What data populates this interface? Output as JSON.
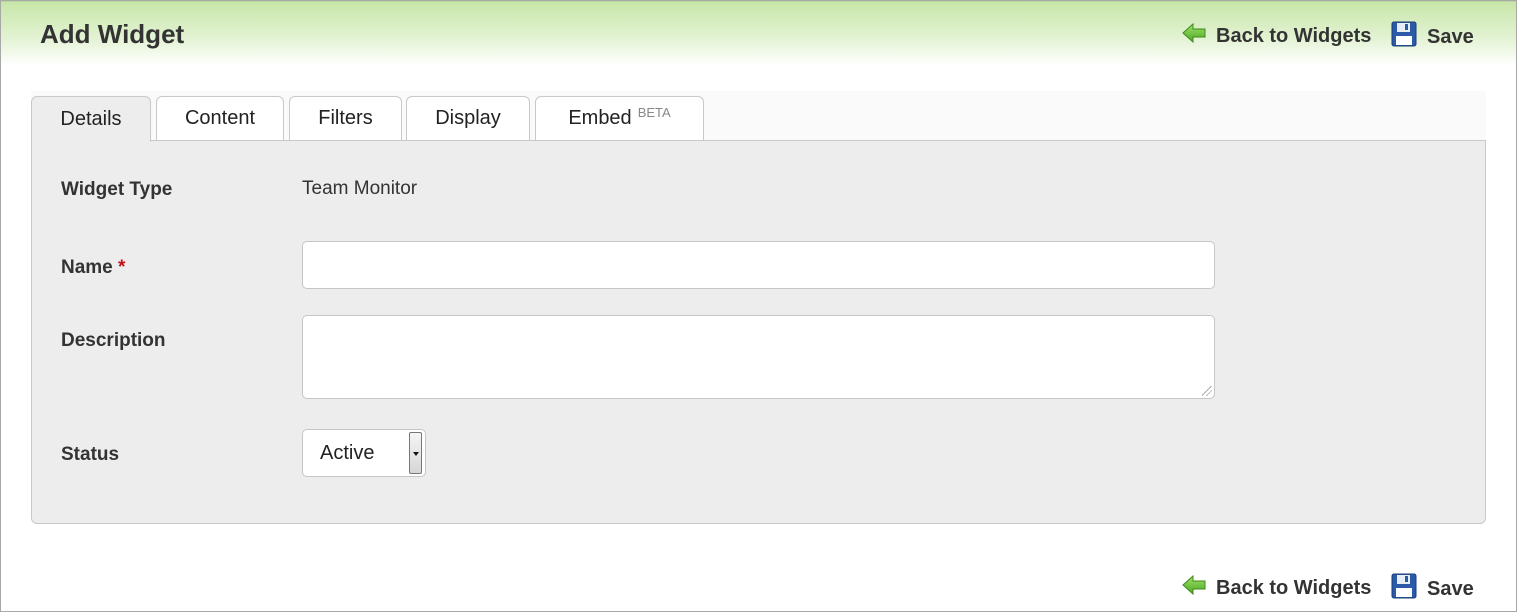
{
  "header": {
    "title": "Add Widget",
    "back_label": "Back to Widgets",
    "save_label": "Save"
  },
  "icons": {
    "back": "green-arrow-left-icon",
    "save": "floppy-disk-icon"
  },
  "tabs": [
    {
      "label": "Details",
      "active": true
    },
    {
      "label": "Content",
      "active": false
    },
    {
      "label": "Filters",
      "active": false
    },
    {
      "label": "Display",
      "active": false
    },
    {
      "label": "Embed",
      "badge": "BETA",
      "active": false
    }
  ],
  "form": {
    "widget_type_label": "Widget Type",
    "widget_type_value": "Team Monitor",
    "name_label": "Name",
    "required_marker": "*",
    "name_value": "",
    "description_label": "Description",
    "description_value": "",
    "status_label": "Status",
    "status_value": "Active"
  },
  "footer": {
    "back_label": "Back to Widgets",
    "save_label": "Save"
  },
  "colors": {
    "header_gradient_top": "#c8e6a8",
    "required": "#c0111a",
    "panel_bg": "#ededed",
    "back_arrow": "#6cc43a",
    "save_icon": "#2a5aa8"
  }
}
